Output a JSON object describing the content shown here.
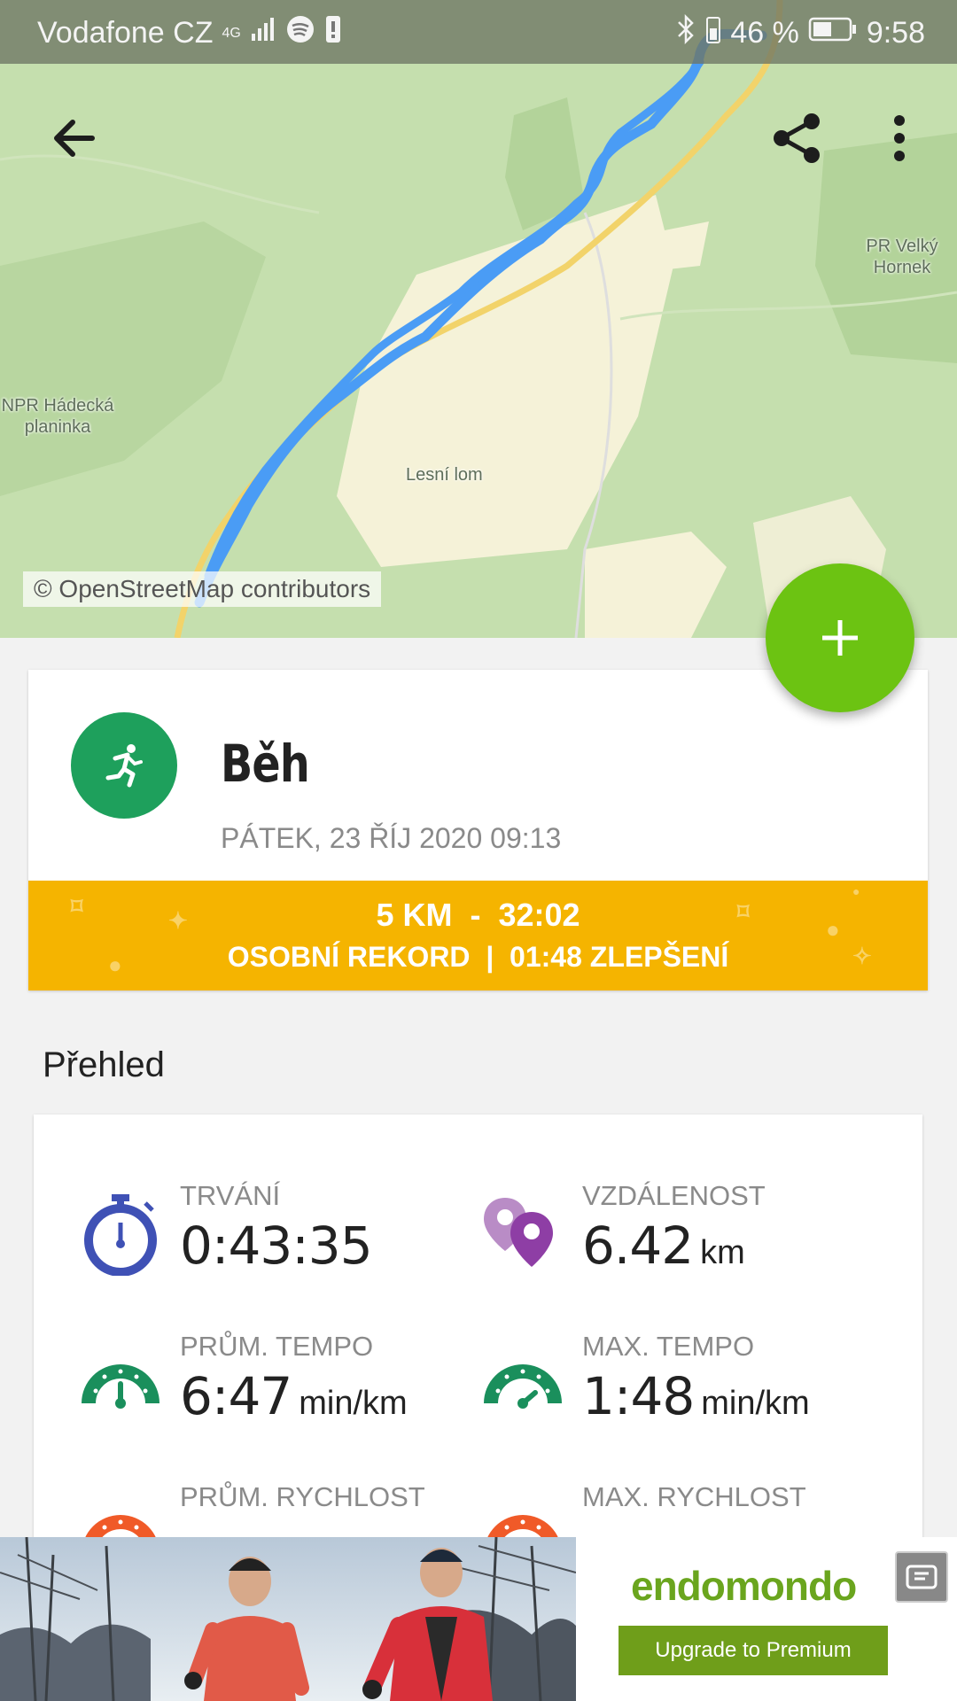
{
  "status_bar": {
    "carrier": "Vodafone CZ",
    "network": "4G",
    "battery_percent": "46 %",
    "time": "9:58"
  },
  "map": {
    "attribution": "© OpenStreetMap contributors",
    "labels": {
      "pr_velky_hornek": "PR Velký Hornek",
      "npr_hadecka": "NPR Hádecká planinka",
      "lesni_lom": "Lesní lom"
    }
  },
  "workout": {
    "sport": "Běh",
    "date": "PÁTEK, 23 ŘÍJ 2020 09:13",
    "record_line1": "5 KM  -  32:02",
    "record_line2": "OSOBNÍ REKORD  |  01:48 ZLEPŠENÍ"
  },
  "overview": {
    "title": "Přehled",
    "stats": [
      {
        "label": "TRVÁNÍ",
        "value": "0:43:35",
        "unit": ""
      },
      {
        "label": "VZDÁLENOST",
        "value": "6.42",
        "unit": "km"
      },
      {
        "label": "PRŮM. TEMPO",
        "value": "6:47",
        "unit": "min/km"
      },
      {
        "label": "MAX. TEMPO",
        "value": "1:48",
        "unit": "min/km"
      },
      {
        "label": "PRŮM. RYCHLOST",
        "value": "",
        "unit": ""
      },
      {
        "label": "MAX. RYCHLOST",
        "value": "",
        "unit": ""
      }
    ]
  },
  "ad": {
    "brand": "endomondo",
    "cta": "Upgrade to Premium"
  },
  "colors": {
    "accent_green": "#6cc312",
    "sport_green": "#1ea05c",
    "record_yellow": "#f5b400",
    "stopwatch_blue": "#3f51b5",
    "distance_purple": "#8e3ea5",
    "tempo_green": "#1a8f5c",
    "speed_orange": "#f05a28"
  }
}
